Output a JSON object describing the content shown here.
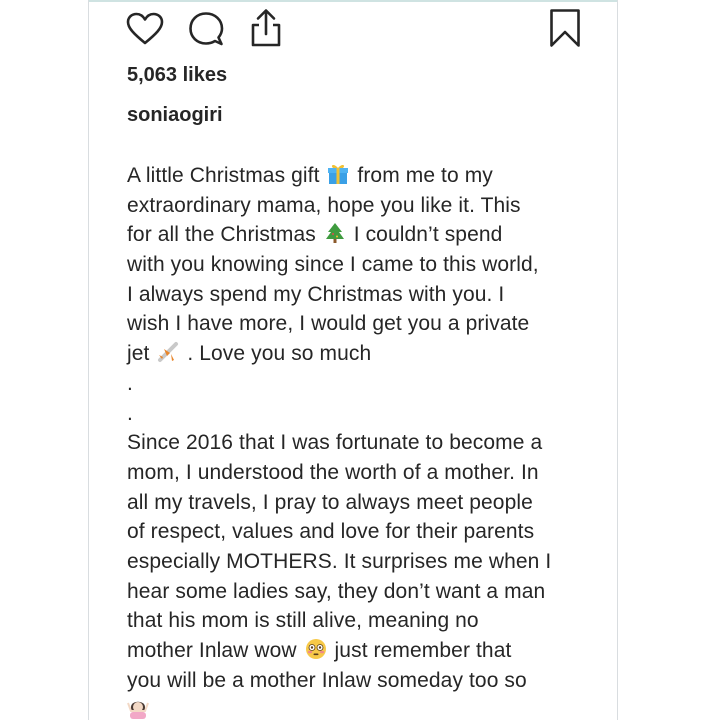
{
  "post": {
    "likes": "5,063 likes",
    "username": "soniaogiri",
    "caption_lines": [
      "A little Christmas gift",
      "from me to my",
      "extraordinary mama, hope you like it. This",
      "for all the Christmas",
      "I couldn’t spend",
      "with you knowing since I came to this world,",
      "I always spend my Christmas with you. I",
      "wish I have more, I would get you a private",
      "jet",
      ". Love you so much",
      ".",
      ".",
      "Since 2016 that I was fortunate to become a",
      "mom, I understood the worth of a mother. In",
      "all my travels, I pray to always meet people",
      "of respect, values and love for their parents",
      "especially MOTHERS. It surprises me when I",
      "hear some ladies say, they don’t want a man",
      "that his mom is still alive, meaning no",
      "mother Inlaw wow",
      "just remember that",
      "you will be a mother Inlaw someday too so"
    ]
  },
  "icons": {
    "like": "heart-outline",
    "comment": "speech-bubble",
    "share": "share-up-arrow",
    "save": "bookmark",
    "gift": "gift-emoji",
    "tree": "christmas-tree-emoji",
    "plane": "airplane-emoji",
    "flushed": "flushed-face-emoji",
    "shrug": "woman-shrugging-emoji"
  },
  "colors": {
    "text": "#262626",
    "border": "#d9dde0"
  }
}
